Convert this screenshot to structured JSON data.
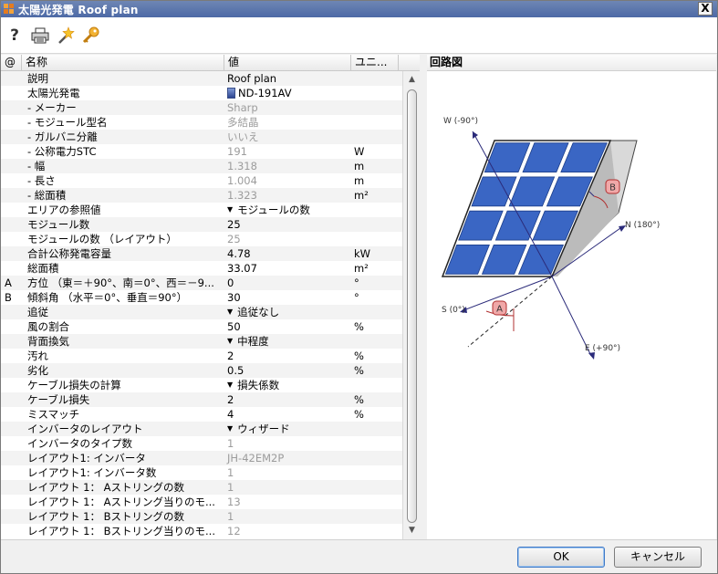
{
  "window": {
    "title": "太陽光発電 Roof plan",
    "close_label": "X"
  },
  "toolbar": {
    "icons": [
      "help-icon",
      "print-icon",
      "wizard-icon",
      "key-icon"
    ],
    "help_label": "?"
  },
  "grid": {
    "headers": [
      "@",
      "名称",
      "値",
      "ユニ..."
    ],
    "rows": [
      {
        "at": "",
        "name": "説明",
        "value": "Roof plan",
        "unit": "",
        "dim": false
      },
      {
        "at": "",
        "name": "太陽光発電",
        "value": "ND-191AV",
        "unit": "",
        "dim": false,
        "icon": "solar-panel-icon"
      },
      {
        "at": "",
        "name": "- メーカー",
        "value": "Sharp",
        "unit": "",
        "dim": true
      },
      {
        "at": "",
        "name": "- モジュール型名",
        "value": "多結晶",
        "unit": "",
        "dim": true
      },
      {
        "at": "",
        "name": "- ガルバニ分離",
        "value": "いいえ",
        "unit": "",
        "dim": true
      },
      {
        "at": "",
        "name": "- 公称電力STC",
        "value": "191",
        "unit": "W",
        "dim": true
      },
      {
        "at": "",
        "name": "- 幅",
        "value": "1.318",
        "unit": "m",
        "dim": true
      },
      {
        "at": "",
        "name": "- 長さ",
        "value": "1.004",
        "unit": "m",
        "dim": true
      },
      {
        "at": "",
        "name": "- 総面積",
        "value": "1.323",
        "unit": "m²",
        "dim": true
      },
      {
        "at": "",
        "name": "エリアの参照値",
        "value": "モジュールの数",
        "unit": "",
        "dim": false,
        "dropdown": true
      },
      {
        "at": "",
        "name": "モジュール数",
        "value": "25",
        "unit": "",
        "dim": false
      },
      {
        "at": "",
        "name": "モジュールの数 （レイアウト）",
        "value": "25",
        "unit": "",
        "dim": true
      },
      {
        "at": "",
        "name": "合計公称発電容量",
        "value": "4.78",
        "unit": "kW",
        "dim": false
      },
      {
        "at": "",
        "name": "総面積",
        "value": "33.07",
        "unit": "m²",
        "dim": false
      },
      {
        "at": "A",
        "name": "方位 （東＝＋90°、南＝0°、西＝－9...",
        "value": "0",
        "unit": "°",
        "dim": false
      },
      {
        "at": "B",
        "name": "傾斜角 （水平＝0°、垂直＝90°）",
        "value": "30",
        "unit": "°",
        "dim": false
      },
      {
        "at": "",
        "name": "追従",
        "value": "追従なし",
        "unit": "",
        "dim": false,
        "dropdown": true
      },
      {
        "at": "",
        "name": "風の割合",
        "value": "50",
        "unit": "%",
        "dim": false
      },
      {
        "at": "",
        "name": "背面換気",
        "value": "中程度",
        "unit": "",
        "dim": false,
        "dropdown": true
      },
      {
        "at": "",
        "name": "汚れ",
        "value": "2",
        "unit": "%",
        "dim": false
      },
      {
        "at": "",
        "name": "劣化",
        "value": "0.5",
        "unit": "%",
        "dim": false
      },
      {
        "at": "",
        "name": "ケーブル損失の計算",
        "value": "損失係数",
        "unit": "",
        "dim": false,
        "dropdown": true
      },
      {
        "at": "",
        "name": "ケーブル損失",
        "value": "2",
        "unit": "%",
        "dim": false
      },
      {
        "at": "",
        "name": "ミスマッチ",
        "value": "4",
        "unit": "%",
        "dim": false
      },
      {
        "at": "",
        "name": "インバータのレイアウト",
        "value": "ウィザード",
        "unit": "",
        "dim": false,
        "dropdown": true
      },
      {
        "at": "",
        "name": "インバータのタイプ数",
        "value": "1",
        "unit": "",
        "dim": true
      },
      {
        "at": "",
        "name": "レイアウト1: インバータ",
        "value": "JH-42EM2P",
        "unit": "",
        "dim": true
      },
      {
        "at": "",
        "name": "レイアウト1: インバータ数",
        "value": "1",
        "unit": "",
        "dim": true
      },
      {
        "at": "",
        "name": "レイアウト 1： Aストリングの数",
        "value": "1",
        "unit": "",
        "dim": true
      },
      {
        "at": "",
        "name": "レイアウト 1： Aストリング当りのモ...",
        "value": "13",
        "unit": "",
        "dim": true
      },
      {
        "at": "",
        "name": "レイアウト 1： Bストリングの数",
        "value": "1",
        "unit": "",
        "dim": true
      },
      {
        "at": "",
        "name": "レイアウト 1： Bストリング当りのモ...",
        "value": "12",
        "unit": "",
        "dim": true
      }
    ]
  },
  "diagram": {
    "title": "回路図",
    "labels": {
      "west": "W (-90°)",
      "north": "N (180°)",
      "south": "S (0°)",
      "east": "E (+90°)",
      "marker_a": "A",
      "marker_b": "B"
    },
    "colors": {
      "panel_cell": "#3a66c4",
      "arrow": "#2b2b7a",
      "marker": "#f0a8a8"
    }
  },
  "footer": {
    "ok_label": "OK",
    "cancel_label": "キャンセル"
  }
}
